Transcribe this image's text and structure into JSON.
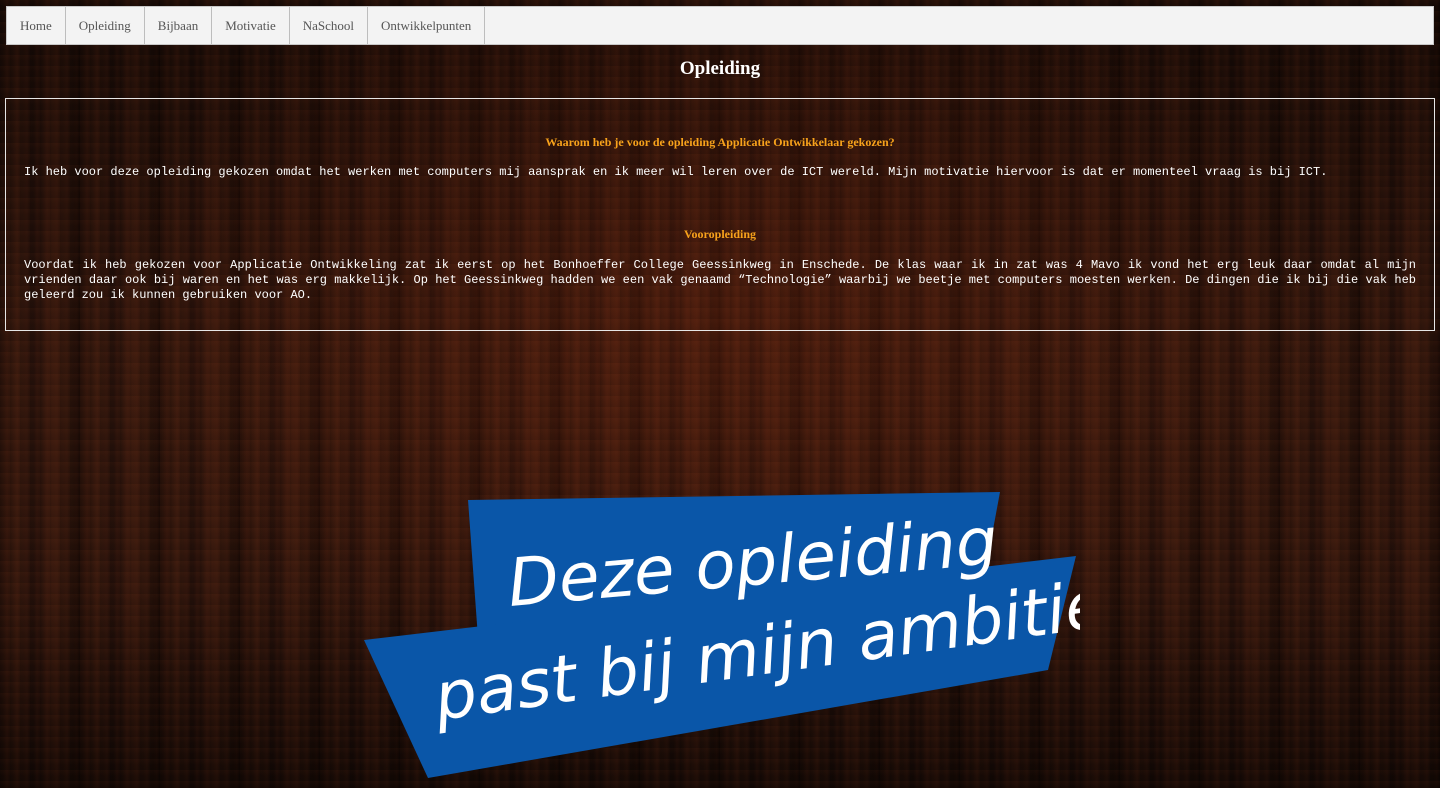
{
  "nav": {
    "items": [
      {
        "label": "Home"
      },
      {
        "label": "Opleiding"
      },
      {
        "label": "Bijbaan"
      },
      {
        "label": "Motivatie"
      },
      {
        "label": "NaSchool"
      },
      {
        "label": "Ontwikkelpunten"
      }
    ]
  },
  "page": {
    "title": "Opleiding"
  },
  "sections": [
    {
      "heading": "Waarom heb je voor de opleiding Applicatie Ontwikkelaar gekozen?",
      "text": "Ik heb voor deze opleiding gekozen omdat het werken met computers mij aansprak en ik meer wil leren over de ICT wereld. Mijn motivatie hiervoor is dat er momenteel vraag is bij ICT."
    },
    {
      "heading": "Vooropleiding",
      "text": "Voordat ik heb gekozen voor Applicatie Ontwikkeling zat ik eerst op het Bonhoeffer College Geessinkweg in Enschede. De klas waar ik in zat was 4 Mavo ik vond het erg leuk daar omdat al mijn vrienden daar ook bij waren en het was erg makkelijk. Op het Geessinkweg hadden we een vak genaamd “Technologie” waarbij we beetje met computers moesten werken. De dingen die ik bij die vak heb geleerd zou ik kunnen gebruiken voor AO."
    }
  ],
  "banner": {
    "line1": "Deze opleiding",
    "line2": "past bij mijn ambitie!"
  },
  "colors": {
    "heading_accent": "#f7a21b",
    "banner_blue": "#0a56a8",
    "nav_bg": "#f3f3f3"
  }
}
